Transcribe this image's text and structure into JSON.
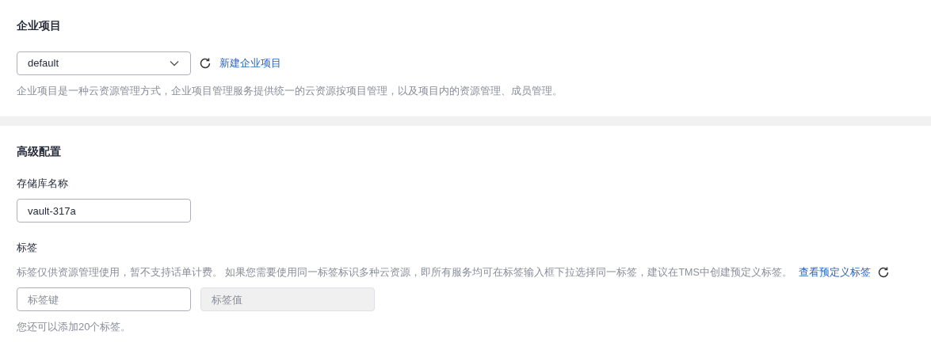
{
  "enterprise_project": {
    "title": "企业项目",
    "select": {
      "value": "default"
    },
    "create_link": "新建企业项目",
    "description": "企业项目是一种云资源管理方式，企业项目管理服务提供统一的云资源按项目管理，以及项目内的资源管理、成员管理。"
  },
  "advanced": {
    "title": "高级配置",
    "vault_name": {
      "label": "存储库名称",
      "value": "vault-317a"
    },
    "tags": {
      "label": "标签",
      "hint": "标签仅供资源管理使用，暂不支持话单计费。 如果您需要使用同一标签标识多种云资源，即所有服务均可在标签输入框下拉选择同一标签，建议在TMS中创建预定义标签。",
      "hint_link": "查看预定义标签",
      "fields": [
        {
          "placeholder": "标签键",
          "disabled": false
        },
        {
          "placeholder": "标签值",
          "disabled": true
        }
      ],
      "remaining": "您还可以添加20个标签。"
    }
  }
}
